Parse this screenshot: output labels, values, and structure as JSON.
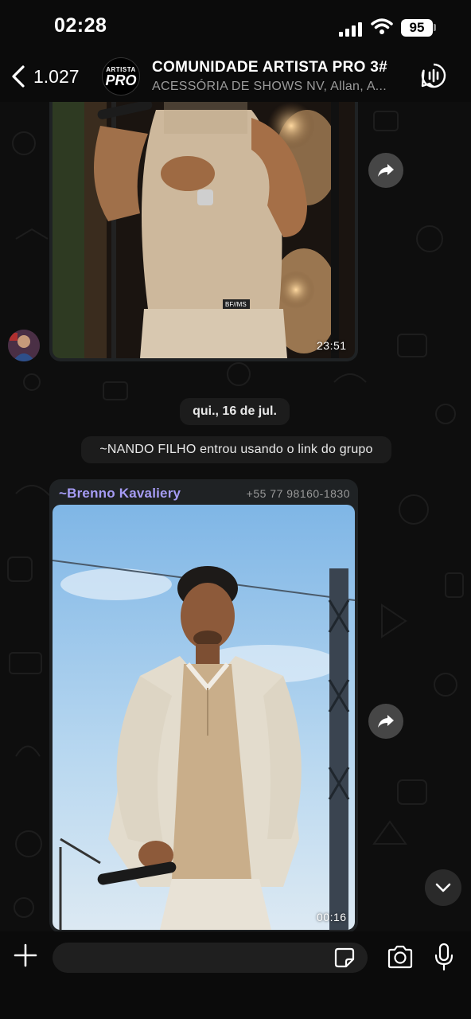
{
  "status_bar": {
    "time": "02:28",
    "battery": "95"
  },
  "header": {
    "back_count": "1.027",
    "avatar_line1": "ARTISTA",
    "avatar_line2": "PRO",
    "title": "COMUNIDADE ARTISTA PRO 3#",
    "subtitle": "ACESSÓRIA DE SHOWS NV, Allan, A..."
  },
  "messages": {
    "first_media": {
      "time": "23:51",
      "shirt_tag": "BF//MS"
    },
    "date_separator": "qui., 16 de jul.",
    "system_notice": "~NANDO FILHO entrou usando o link do grupo",
    "second_media": {
      "sender": "~Brenno Kavaliery",
      "phone": "+55 77 98160-1830",
      "duration": "00:16"
    }
  },
  "input": {
    "placeholder": ""
  },
  "colors": {
    "sender_name": "#a69cf5",
    "bubble": "#1f2224",
    "background": "#0e0e0e"
  },
  "icons": [
    "back-chevron-icon",
    "call-waveform-icon",
    "forward-arrow-icon",
    "chevron-down-icon",
    "plus-icon",
    "sticker-icon",
    "camera-icon",
    "microphone-icon",
    "signal-icon",
    "wifi-icon"
  ]
}
